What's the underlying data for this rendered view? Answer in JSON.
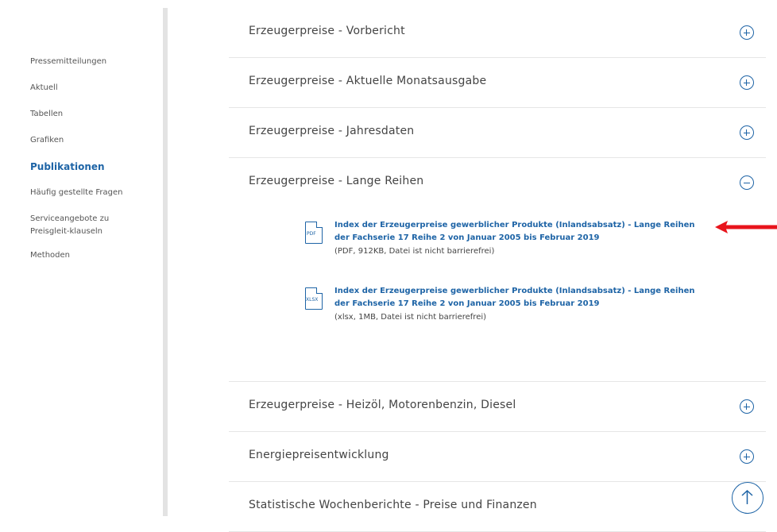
{
  "sidebar": {
    "items": [
      {
        "label": "Pressemitteilungen",
        "active": false
      },
      {
        "label": "Aktuell",
        "active": false
      },
      {
        "label": "Tabellen",
        "active": false
      },
      {
        "label": "Grafiken",
        "active": false
      },
      {
        "label": "Publikationen",
        "active": true
      },
      {
        "label": "Häufig gestellte Fragen",
        "active": false
      },
      {
        "label": "Serviceangebote zu Preisgleit-klauseln",
        "active": false
      },
      {
        "label": "Methoden",
        "active": false
      }
    ]
  },
  "accordion": [
    {
      "title": "Erzeugerpreise - Vorbericht",
      "state": "collapsed"
    },
    {
      "title": "Erzeugerpreise - Aktuelle Monatsausgabe",
      "state": "collapsed"
    },
    {
      "title": "Erzeugerpreise - Jahresdaten",
      "state": "collapsed"
    },
    {
      "title": "Erzeugerpreise - Lange Reihen",
      "state": "expanded"
    },
    {
      "title": "Erzeugerpreise - Heizöl, Motorenbenzin, Diesel",
      "state": "collapsed"
    },
    {
      "title": "Energiepreisentwicklung",
      "state": "collapsed"
    },
    {
      "title": "Statistische Wochenberichte - Preise und Finanzen",
      "state": "collapsed"
    }
  ],
  "files": [
    {
      "icon_label": "PDF",
      "icon": "pdf-file-icon",
      "link_line1": "Index der Erzeugerpreise gewerblicher Produkte (Inlandsabsatz) - Lange Reihen",
      "link_line2": "der Fachserie 17 Reihe 2 von Januar 2005 bis Februar 2019",
      "meta": "(PDF, 912KB, Datei ist nicht barrierefrei)"
    },
    {
      "icon_label": "XLSX",
      "icon": "xlsx-file-icon",
      "link_line1": "Index der Erzeugerpreise gewerblicher Produkte (Inlandsabsatz) - Lange Reihen",
      "link_line2": "der Fachserie 17 Reihe 2 von Januar 2005 bis Februar 2019",
      "meta": "(xlsx, 1MB, Datei ist nicht barrierefrei)"
    }
  ],
  "colors": {
    "accent": "#1e64a6",
    "annotation_arrow": "#e8141c"
  },
  "icons": {
    "expand": "plus-circle-icon",
    "collapse": "minus-circle-icon",
    "back_to_top": "arrow-up-circle-icon"
  }
}
